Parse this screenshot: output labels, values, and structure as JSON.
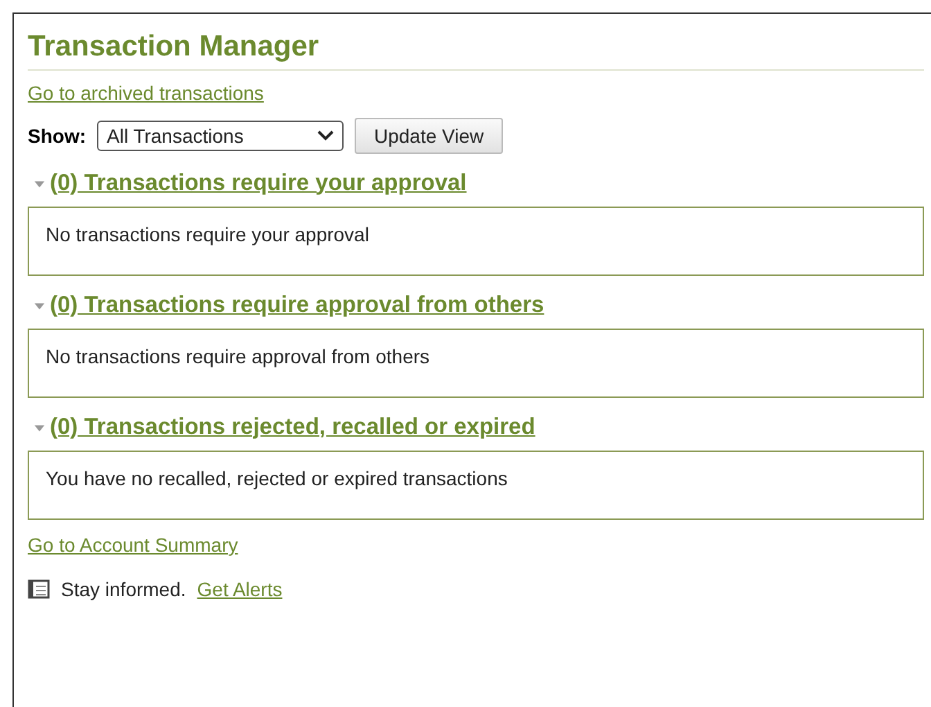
{
  "title": "Transaction Manager",
  "archive_link": "Go to archived transactions",
  "filter": {
    "label": "Show:",
    "value": "All Transactions",
    "button": "Update View"
  },
  "sections": [
    {
      "heading": "(0) Transactions require your approval",
      "expanded": true,
      "message": "No transactions require your approval"
    },
    {
      "heading": "(0) Transactions require approval from others",
      "expanded": true,
      "message": "No transactions require approval from others"
    },
    {
      "heading": "(0) Transactions rejected, recalled or expired",
      "expanded": true,
      "message": "You have no recalled, rejected or expired transactions"
    }
  ],
  "footer_link": "Go to Account Summary",
  "alerts": {
    "text": "Stay informed.",
    "link": "Get Alerts"
  }
}
